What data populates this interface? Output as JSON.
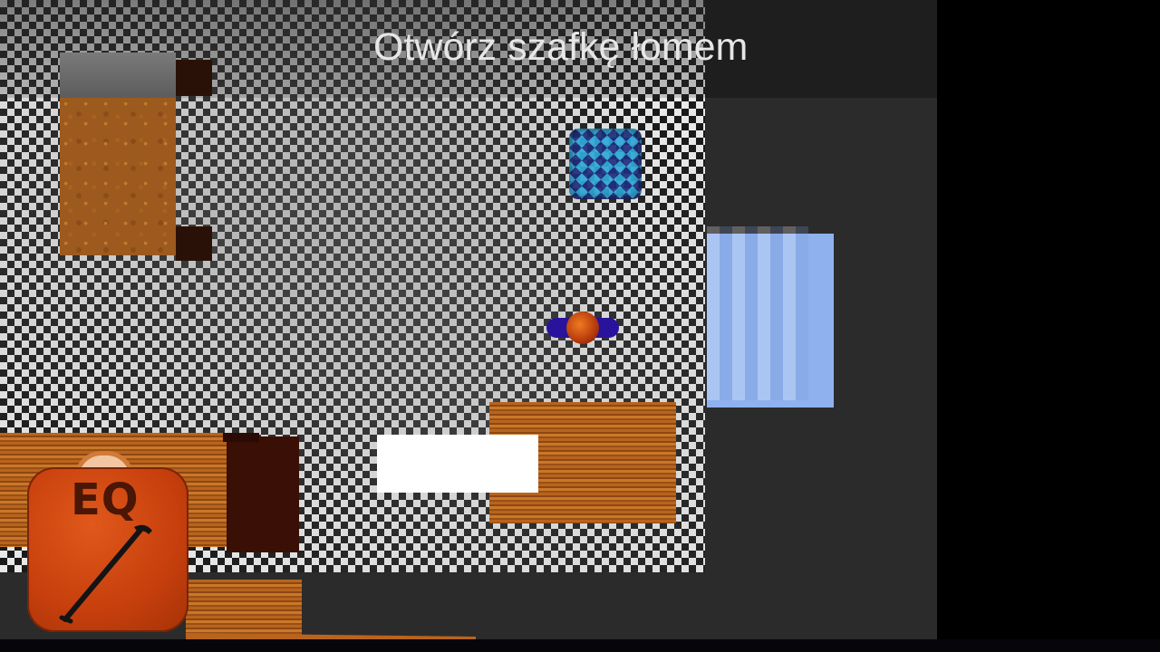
{
  "hud": {
    "objective": "Otwórz szafkę łomem",
    "equipment_button_label": "EQ",
    "equipped_item_icon": "crowbar-icon"
  },
  "colors": {
    "background": "#2b2b2b",
    "floor_dark": "#1a1a1a",
    "floor_light": "#e8e8e8",
    "objective_text": "#e6e6e6",
    "eq_button": "#c63f0d",
    "player_body": "#2a139c",
    "crate": "#1f2f7e",
    "window": "#8fb2ee",
    "wood": "#b8641e"
  }
}
